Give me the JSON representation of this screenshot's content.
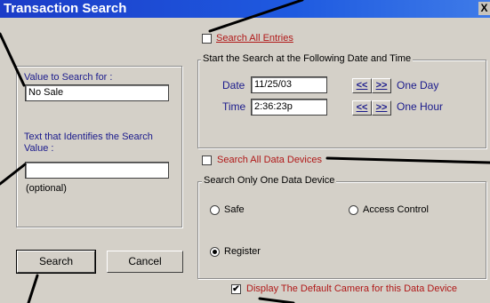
{
  "window": {
    "title": "Transaction Search",
    "close_symbol": "X"
  },
  "left": {
    "value_label": "Value to Search for :",
    "value_input": "No Sale",
    "text_label": "Text that Identifies the Search Value :",
    "text_input": "",
    "optional_note": "(optional)",
    "search_button": "Search",
    "cancel_button": "Cancel"
  },
  "date_section": {
    "search_all_entries": {
      "label": "Search All Entries",
      "checked": false
    },
    "group_title": "Start the Search at the Following Date and Time",
    "date_label": "Date",
    "date_value": "11/25/03",
    "time_label": "Time",
    "time_value": "2:36:23p",
    "prev_symbol": "<<",
    "next_symbol": ">>",
    "one_day": "One Day",
    "one_hour": "One Hour"
  },
  "device_section": {
    "search_all_devices": {
      "label": "Search All Data Devices",
      "checked": false
    },
    "group_title": "Search Only One Data Device",
    "options": [
      {
        "label": "Safe",
        "selected": false
      },
      {
        "label": "Access Control",
        "selected": false
      },
      {
        "label": "Register",
        "selected": true
      }
    ],
    "display_camera": {
      "label": "Display The Default Camera for this Data Device",
      "checked": true
    }
  },
  "colors": {
    "title_bar": "#1c3cc8",
    "label_navy": "#1a1a8c",
    "label_red": "#b01818",
    "dialog_bg": "#d4d0c8"
  }
}
